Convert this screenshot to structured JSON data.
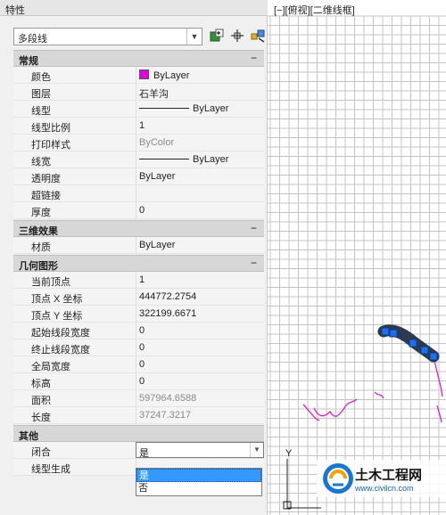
{
  "palette": {
    "title": "特性",
    "object_type": "多段线",
    "toolbar": {
      "select_objects_icon": "select-objects-icon",
      "pick_add_icon": "pick-add-icon",
      "quick_select_icon": "quick-select-icon"
    },
    "categories": [
      {
        "label": "常规",
        "toggle": "−",
        "rows": [
          {
            "name": "颜色",
            "value": "ByLayer",
            "kind": "color",
            "swatch": "#e000e0"
          },
          {
            "name": "图层",
            "value": "石羊沟"
          },
          {
            "name": "线型",
            "value": "ByLayer",
            "kind": "line"
          },
          {
            "name": "线型比例",
            "value": "1"
          },
          {
            "name": "打印样式",
            "value": "ByColor",
            "grey": true
          },
          {
            "name": "线宽",
            "value": "ByLayer",
            "kind": "line"
          },
          {
            "name": "透明度",
            "value": "ByLayer"
          },
          {
            "name": "超链接",
            "value": ""
          },
          {
            "name": "厚度",
            "value": "0"
          }
        ]
      },
      {
        "label": "三维效果",
        "toggle": "−",
        "rows": [
          {
            "name": "材质",
            "value": "ByLayer"
          }
        ]
      },
      {
        "label": "几何图形",
        "toggle": "−",
        "rows": [
          {
            "name": "当前顶点",
            "value": "1"
          },
          {
            "name": "顶点 X 坐标",
            "value": "444772.2754"
          },
          {
            "name": "顶点 Y 坐标",
            "value": "322199.6671"
          },
          {
            "name": "起始线段宽度",
            "value": "0"
          },
          {
            "name": "终止线段宽度",
            "value": "0"
          },
          {
            "name": "全局宽度",
            "value": "0"
          },
          {
            "name": "标高",
            "value": "0"
          },
          {
            "name": "面积",
            "value": "597964.6588",
            "grey": true
          },
          {
            "name": "长度",
            "value": "37247.3217",
            "grey": true
          }
        ]
      },
      {
        "label": "其他",
        "toggle": "",
        "rows": [
          {
            "name": "闭合",
            "value": "是",
            "active": true
          },
          {
            "name": "线型生成",
            "value": ""
          }
        ]
      }
    ],
    "dropdown_options": [
      "是",
      "否"
    ],
    "dropdown_selected": "是"
  },
  "viewport": {
    "label": "[−][俯视][二维线框]",
    "ucs_y_label": "Y",
    "grid_color": "#c4c4c4",
    "polyline_color": "#e020c0",
    "selected_polyline_color": "#2b3a4e",
    "grip_color": "#1e6fe8"
  },
  "watermark": {
    "text": "土木工程网",
    "url": "www.civilcn.com"
  }
}
